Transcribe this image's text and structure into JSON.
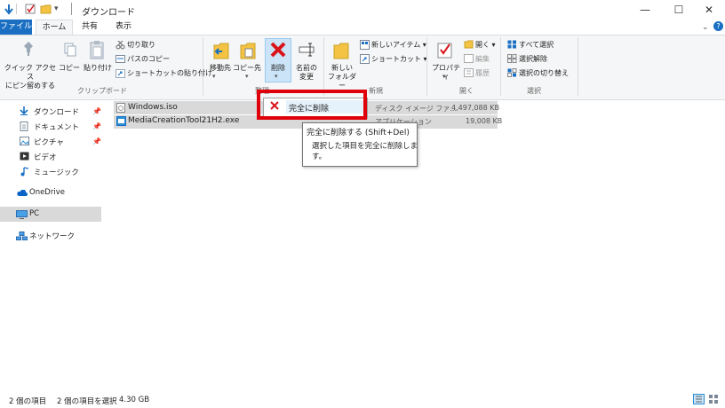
{
  "window": {
    "title": "ダウンロード",
    "minimize": "—",
    "maximize": "☐",
    "close": "✕"
  },
  "tabs": [
    {
      "label": "ファイル"
    },
    {
      "label": "ホーム"
    },
    {
      "label": "共有"
    },
    {
      "label": "表示"
    }
  ],
  "ribbon": {
    "clipboard": {
      "pin_label_1": "クイック アクセス",
      "pin_label_2": "にピン留めする",
      "copy_label": "コピー",
      "paste_label": "貼り付け",
      "cut_label": "切り取り",
      "copy_path_label": "パスのコピー",
      "paste_shortcut_label": "ショートカットの貼り付け",
      "group_label": "クリップボード"
    },
    "organize": {
      "move_label": "移動先",
      "copyto_label": "コピー先",
      "delete_label": "削除",
      "rename_label_1": "名前の",
      "rename_label_2": "変更",
      "group_label": "整理"
    },
    "new": {
      "new_folder_label_1": "新しい",
      "new_folder_label_2": "フォルダー",
      "new_item_label": "新しいアイテム",
      "shortcut_label": "ショートカット",
      "group_label": "新規"
    },
    "open": {
      "properties_label": "プロパティ",
      "open_label": "開く",
      "edit_label": "編集",
      "history_label": "履歴",
      "group_label": "開く"
    },
    "select": {
      "select_all_label": "すべて選択",
      "select_none_label": "選択解除",
      "invert_label": "選択の切り替え",
      "group_label": "選択"
    }
  },
  "nav": {
    "items": [
      {
        "label": "ダウンロード"
      },
      {
        "label": "ドキュメント"
      },
      {
        "label": "ピクチャ"
      },
      {
        "label": "ビデオ"
      },
      {
        "label": "ミュージック"
      },
      {
        "label": "OneDrive"
      },
      {
        "label": "PC"
      },
      {
        "label": "ネットワーク"
      }
    ]
  },
  "files": [
    {
      "name": "Windows.iso",
      "type": "ディスク イメージ ファ...",
      "size": "4,497,088 KB"
    },
    {
      "name": "MediaCreationTool21H2.exe",
      "type": "アプリケーション",
      "size": "19,008 KB"
    }
  ],
  "dropdown": {
    "permanent_delete_label": "完全に削除"
  },
  "tooltip": {
    "title": "完全に削除する (Shift+Del)",
    "body_1": "選択した項目を完全に削除しま",
    "body_2": "す。"
  },
  "status": {
    "item_count": "2 個の項目",
    "selected": "2 個の項目を選択",
    "size": "4.30 GB"
  },
  "colors": {
    "accent": "#1a6fc2",
    "highlight_box": "#e0000a",
    "delete_red": "#d9141a"
  }
}
